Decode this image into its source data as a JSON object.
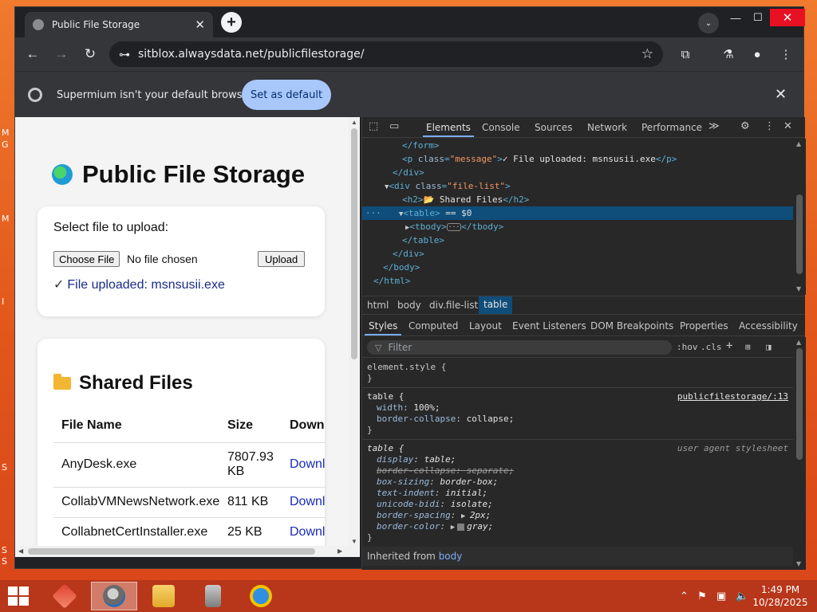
{
  "browser": {
    "tab_title": "Public File Storage",
    "tab_close": "✕",
    "new_tab": "+",
    "tab_search": "⌄",
    "win_min": "—",
    "win_max": "☐",
    "win_close": "✕",
    "back": "←",
    "forward": "→",
    "reload": "↻",
    "url": "sitblox.alwaysdata.net/publicfilestorage/",
    "site_info": "⊶",
    "bookmark": "☆",
    "extensions": "⧉",
    "labs": "⚗",
    "profile": "●",
    "menu": "⋮"
  },
  "infobar": {
    "message": "Supermium isn't your default browser",
    "button": "Set as default",
    "close": "✕"
  },
  "page": {
    "title": "Public File Storage",
    "upload_label": "Select file to upload:",
    "choose_file": "Choose File",
    "no_file": "No file chosen",
    "upload_button": "Upload",
    "check": "✓",
    "upload_message": "File uploaded: msnsusii.exe",
    "shared_title": "Shared Files",
    "table_headers": [
      "File Name",
      "Size",
      "Download"
    ],
    "files": [
      {
        "name": "AnyDesk.exe",
        "size": "7807.93 KB",
        "link": "Download"
      },
      {
        "name": "CollabVMNewsNetwork.exe",
        "size": "811 KB",
        "link": "Download"
      },
      {
        "name": "CollabnetCertInstaller.exe",
        "size": "25 KB",
        "link": "Download"
      }
    ]
  },
  "devtools": {
    "tool_icons": {
      "inspect": "⬚",
      "device": "▭",
      "more_tabs": "≫",
      "settings": "⚙",
      "menu": "⋮",
      "close": "✕"
    },
    "tabs": [
      "Elements",
      "Console",
      "Sources",
      "Network",
      "Performance"
    ],
    "dom": {
      "l1": "</form>",
      "l2_tag": "<p ",
      "l2_attr": "class",
      "l2_val": "\"message\"",
      "l2_text": "✓ File uploaded: msnsusii.exe",
      "l2_close": "</p>",
      "l3": "</div>",
      "l4_tag": "<div ",
      "l4_attr": "class",
      "l4_val": "\"file-list\"",
      "l5_tag": "<h2>",
      "l5_text": "📂 Shared Files",
      "l5_close": "</h2>",
      "l6_dots": "···",
      "l6_tag": "<table>",
      "l6_eq": " == $0",
      "l7_tag": "<tbody>",
      "l7_ell": "···",
      "l7_close": "</tbody>",
      "l8": "</table>",
      "l9": "</div>",
      "l10": "</body>",
      "l11": "</html>"
    },
    "breadcrumbs": [
      "html",
      "body",
      "div.file-list",
      "table"
    ],
    "subtabs": [
      "Styles",
      "Computed",
      "Layout",
      "Event Listeners",
      "DOM Breakpoints",
      "Properties",
      "Accessibility"
    ],
    "filter_placeholder": "Filter",
    "filter_buttons": [
      ":hov",
      ".cls",
      "+"
    ],
    "styles": {
      "element_style": "element.style {",
      "close_brace": "}",
      "rule1_selector": "table {",
      "rule1_source": "publicfilestorage/:13",
      "rule1_props": [
        {
          "name": "width",
          "value": "100%;"
        },
        {
          "name": "border-collapse",
          "value": "collapse;"
        }
      ],
      "rule2_selector": "table {",
      "rule2_source": "user agent stylesheet",
      "rule2_props": [
        {
          "name": "display",
          "value": "table;"
        },
        {
          "name": "border-collapse",
          "value": "separate;"
        },
        {
          "name": "box-sizing",
          "value": "border-box;"
        },
        {
          "name": "text-indent",
          "value": "initial;"
        },
        {
          "name": "unicode-bidi",
          "value": "isolate;"
        },
        {
          "name": "border-spacing",
          "value": "2px;"
        },
        {
          "name": "border-color",
          "value": "gray;"
        }
      ],
      "inherited_label": "Inherited from",
      "inherited_from": "body"
    }
  },
  "taskbar": {
    "time": "1:49 PM",
    "date": "10/28/2025"
  },
  "colors": {
    "devtools_bg": "#282828",
    "selected_row": "#0f4d7a",
    "accent_blue": "#7cacf8",
    "taskbar": "#b8361a",
    "close_red": "#e81123"
  }
}
